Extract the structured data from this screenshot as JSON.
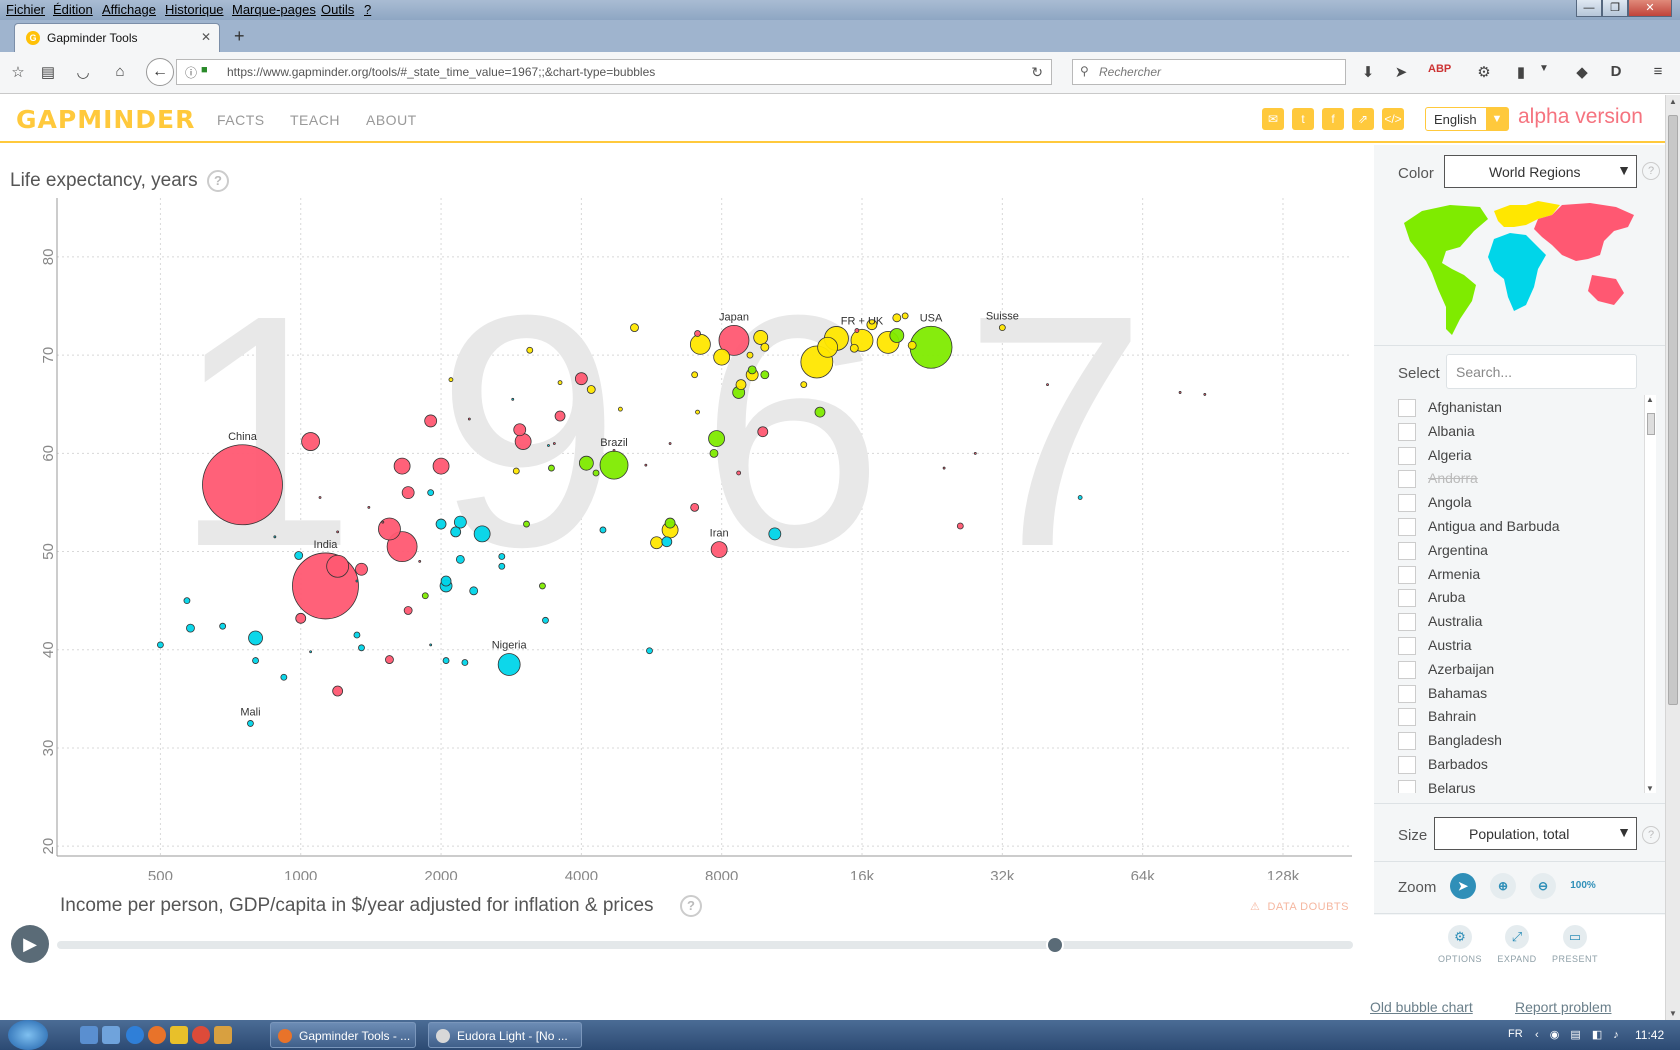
{
  "browser": {
    "menu": [
      "Fichier",
      "Édition",
      "Affichage",
      "Historique",
      "Marque-pages",
      "Outils",
      "?"
    ],
    "tab_title": "Gapminder Tools",
    "url_host": "https://www.gapminder.org",
    "url_path": "/tools/#_state_time_value=1967;;&chart-type=bubbles",
    "search_placeholder": "Rechercher"
  },
  "header": {
    "logo": "GAPMINDER",
    "nav": [
      "FACTS",
      "TEACH",
      "ABOUT"
    ],
    "language": "English",
    "badge": "alpha version",
    "social_icons": [
      "mail-icon",
      "twitter-icon",
      "facebook-icon",
      "share-icon",
      "embed-icon"
    ]
  },
  "chart": {
    "y_title": "Life expectancy, years",
    "x_title": "Income per person, GDP/capita in $/year adjusted for inflation & prices",
    "data_doubts": "DATA DOUBTS",
    "year": "1967"
  },
  "chart_data": {
    "type": "scatter",
    "title": "",
    "xlabel": "Income per person, GDP/capita in $/year adjusted for inflation & prices",
    "ylabel": "Life expectancy, years",
    "x_scale": "log2",
    "xlim": [
      300,
      180000
    ],
    "ylim": [
      19,
      86
    ],
    "x_ticks": [
      500,
      1000,
      2000,
      4000,
      8000,
      16000,
      32000,
      64000,
      128000
    ],
    "x_tick_labels": [
      "500",
      "1000",
      "2000",
      "4000",
      "8000",
      "16k",
      "32k",
      "64k",
      "128k"
    ],
    "y_ticks": [
      20,
      30,
      40,
      50,
      60,
      70,
      80
    ],
    "y_tick_labels": [
      "20",
      "30",
      "40",
      "50",
      "60",
      "70",
      "80"
    ],
    "grid": true,
    "year": "1967",
    "colors": {
      "Asia": "#ff5872",
      "Africa": "#00d5e9",
      "Americas": "#7feb00",
      "Europe": "#ffe700"
    },
    "labeled": [
      {
        "name": "China",
        "x": 750,
        "y": 56.8,
        "size": 40,
        "region": "Asia"
      },
      {
        "name": "India",
        "x": 1130,
        "y": 46.5,
        "size": 33,
        "region": "Asia"
      },
      {
        "name": "Japan",
        "x": 8500,
        "y": 71.5,
        "size": 15,
        "region": "Asia"
      },
      {
        "name": "USA",
        "x": 22500,
        "y": 70.8,
        "size": 21,
        "region": "Americas"
      },
      {
        "name": "Brazil",
        "x": 4700,
        "y": 58.8,
        "size": 14,
        "region": "Americas"
      },
      {
        "name": "FR + UK",
        "x": 16000,
        "y": 71.5,
        "size": 11,
        "region": "Europe"
      },
      {
        "name": "Suisse",
        "x": 32000,
        "y": 72.8,
        "size": 3,
        "region": "Europe"
      },
      {
        "name": "Iran",
        "x": 7900,
        "y": 50.2,
        "size": 8,
        "region": "Asia"
      },
      {
        "name": "Nigeria",
        "x": 2800,
        "y": 38.5,
        "size": 11,
        "region": "Africa"
      },
      {
        "name": "Mali",
        "x": 780,
        "y": 32.5,
        "size": 3,
        "region": "Africa"
      }
    ],
    "points": [
      [
        1050,
        61.2,
        9,
        "Asia"
      ],
      [
        1650,
        58.7,
        8,
        "Asia"
      ],
      [
        2000,
        58.7,
        8,
        "Asia"
      ],
      [
        1900,
        63.3,
        6,
        "Asia"
      ],
      [
        2950,
        62.4,
        6,
        "Asia"
      ],
      [
        3000,
        61.2,
        8,
        "Asia"
      ],
      [
        3600,
        63.8,
        5,
        "Asia"
      ],
      [
        4000,
        67.6,
        6,
        "Asia"
      ],
      [
        1700,
        56.0,
        6,
        "Asia"
      ],
      [
        1550,
        52.3,
        11,
        "Asia"
      ],
      [
        1650,
        50.5,
        15,
        "Asia"
      ],
      [
        1200,
        48.5,
        11,
        "Asia"
      ],
      [
        1350,
        48.2,
        6,
        "Asia"
      ],
      [
        1000,
        43.2,
        5,
        "Asia"
      ],
      [
        1200,
        35.8,
        5,
        "Asia"
      ],
      [
        1550,
        39.0,
        4,
        "Asia"
      ],
      [
        1700,
        44.0,
        4,
        "Asia"
      ],
      [
        7000,
        54.5,
        4,
        "Asia"
      ],
      [
        9800,
        62.2,
        5,
        "Asia"
      ],
      [
        26000,
        52.6,
        3,
        "Asia"
      ],
      [
        8700,
        58.0,
        2,
        "Asia"
      ],
      [
        7100,
        72.2,
        3,
        "Asia"
      ],
      [
        15600,
        72.5,
        2,
        "Asia"
      ],
      [
        500,
        40.5,
        3,
        "Africa"
      ],
      [
        570,
        45.0,
        3,
        "Africa"
      ],
      [
        580,
        42.2,
        4,
        "Africa"
      ],
      [
        680,
        42.4,
        3,
        "Africa"
      ],
      [
        800,
        41.2,
        7,
        "Africa"
      ],
      [
        800,
        38.9,
        3,
        "Africa"
      ],
      [
        920,
        37.2,
        3,
        "Africa"
      ],
      [
        990,
        49.6,
        4,
        "Africa"
      ],
      [
        2000,
        52.8,
        5,
        "Africa"
      ],
      [
        2200,
        53.0,
        6,
        "Africa"
      ],
      [
        2150,
        52.0,
        5,
        "Africa"
      ],
      [
        2450,
        51.8,
        8,
        "Africa"
      ],
      [
        2200,
        49.2,
        4,
        "Africa"
      ],
      [
        2050,
        46.5,
        6,
        "Africa"
      ],
      [
        2050,
        47.0,
        5,
        "Africa"
      ],
      [
        2350,
        46.0,
        4,
        "Africa"
      ],
      [
        2700,
        49.5,
        3,
        "Africa"
      ],
      [
        2700,
        48.5,
        3,
        "Africa"
      ],
      [
        2050,
        38.9,
        3,
        "Africa"
      ],
      [
        2250,
        38.7,
        3,
        "Africa"
      ],
      [
        3350,
        43.0,
        3,
        "Africa"
      ],
      [
        4450,
        52.2,
        3,
        "Africa"
      ],
      [
        5600,
        39.9,
        3,
        "Africa"
      ],
      [
        6100,
        51.0,
        5,
        "Africa"
      ],
      [
        10400,
        51.8,
        6,
        "Africa"
      ],
      [
        47000,
        55.5,
        2,
        "Africa"
      ],
      [
        1900,
        56.0,
        3,
        "Africa"
      ],
      [
        1350,
        40.2,
        3,
        "Africa"
      ],
      [
        1320,
        41.5,
        3,
        "Africa"
      ],
      [
        3300,
        46.5,
        3,
        "Americas"
      ],
      [
        3450,
        58.5,
        3,
        "Americas"
      ],
      [
        4100,
        59.0,
        7,
        "Americas"
      ],
      [
        4300,
        58.0,
        3,
        "Americas"
      ],
      [
        6200,
        52.9,
        5,
        "Americas"
      ],
      [
        7800,
        61.5,
        8,
        "Americas"
      ],
      [
        7700,
        60.0,
        4,
        "Americas"
      ],
      [
        8700,
        66.2,
        6,
        "Americas"
      ],
      [
        9300,
        68.5,
        4,
        "Americas"
      ],
      [
        9900,
        68.0,
        4,
        "Americas"
      ],
      [
        13000,
        64.2,
        5,
        "Americas"
      ],
      [
        19000,
        72.0,
        7,
        "Americas"
      ],
      [
        3050,
        52.8,
        3,
        "Americas"
      ],
      [
        1850,
        45.5,
        3,
        "Americas"
      ],
      [
        5200,
        72.8,
        4,
        "Europe"
      ],
      [
        5800,
        50.9,
        6,
        "Europe"
      ],
      [
        6200,
        52.2,
        8,
        "Europe"
      ],
      [
        4200,
        66.5,
        4,
        "Europe"
      ],
      [
        7000,
        68.0,
        3,
        "Europe"
      ],
      [
        7200,
        71.1,
        10,
        "Europe"
      ],
      [
        8000,
        69.8,
        8,
        "Europe"
      ],
      [
        8800,
        67.0,
        5,
        "Europe"
      ],
      [
        9300,
        68.0,
        6,
        "Europe"
      ],
      [
        9200,
        70.0,
        3,
        "Europe"
      ],
      [
        9700,
        71.8,
        7,
        "Europe"
      ],
      [
        9900,
        70.8,
        4,
        "Europe"
      ],
      [
        12000,
        67.0,
        3,
        "Europe"
      ],
      [
        12800,
        69.3,
        16,
        "Europe"
      ],
      [
        13500,
        70.8,
        10,
        "Europe"
      ],
      [
        14100,
        71.7,
        12,
        "Europe"
      ],
      [
        15400,
        70.7,
        4,
        "Europe"
      ],
      [
        16800,
        73.1,
        5,
        "Europe"
      ],
      [
        18200,
        71.3,
        11,
        "Europe"
      ],
      [
        19000,
        73.8,
        4,
        "Europe"
      ],
      [
        19800,
        74.0,
        3,
        "Europe"
      ],
      [
        20500,
        71.0,
        4,
        "Europe"
      ],
      [
        3100,
        70.5,
        3,
        "Europe"
      ],
      [
        2100,
        67.5,
        2,
        "Europe"
      ],
      [
        3600,
        67.2,
        2,
        "Europe"
      ],
      [
        4850,
        64.5,
        2,
        "Europe"
      ],
      [
        7100,
        64.2,
        2,
        "Europe"
      ],
      [
        2900,
        58.2,
        3,
        "Europe"
      ],
      [
        1100,
        55.5,
        1,
        "Asia"
      ],
      [
        1200,
        52.0,
        1,
        "Asia"
      ],
      [
        1400,
        54.5,
        1,
        "Asia"
      ],
      [
        1500,
        53.0,
        1,
        "Asia"
      ],
      [
        1800,
        49.0,
        1,
        "Asia"
      ],
      [
        2300,
        63.5,
        1,
        "Asia"
      ],
      [
        3500,
        61.0,
        1,
        "Asia"
      ],
      [
        4700,
        60.3,
        1,
        "Asia"
      ],
      [
        5500,
        58.8,
        1,
        "Asia"
      ],
      [
        6200,
        61.0,
        1,
        "Asia"
      ],
      [
        24000,
        58.5,
        1,
        "Asia"
      ],
      [
        28000,
        60.0,
        1,
        "Asia"
      ],
      [
        40000,
        67.0,
        1,
        "Asia"
      ],
      [
        77000,
        66.2,
        1,
        "Asia"
      ],
      [
        87000,
        66.0,
        1,
        "Asia"
      ],
      [
        1050,
        39.8,
        1,
        "Africa"
      ],
      [
        1900,
        40.5,
        1,
        "Africa"
      ],
      [
        880,
        51.5,
        1,
        "Africa"
      ],
      [
        3400,
        60.8,
        1,
        "Africa"
      ],
      [
        2850,
        65.5,
        1,
        "Africa"
      ],
      [
        1320,
        47.0,
        1,
        "Africa"
      ]
    ]
  },
  "timeslider": {
    "play_label": "play",
    "position": 0.77
  },
  "panel": {
    "color_label": "Color",
    "color_value": "World Regions",
    "select_label": "Select",
    "search_placeholder": "Search...",
    "countries": [
      "Afghanistan",
      "Albania",
      "Algeria",
      "Andorra",
      "Angola",
      "Antigua and Barbuda",
      "Argentina",
      "Armenia",
      "Aruba",
      "Australia",
      "Austria",
      "Azerbaijan",
      "Bahamas",
      "Bahrain",
      "Bangladesh",
      "Barbados",
      "Belarus"
    ],
    "disabled_countries": [
      "Andorra"
    ],
    "size_label": "Size",
    "size_value": "Population, total",
    "zoom_label": "Zoom",
    "zoom_reset": "100%"
  },
  "tools": [
    {
      "label": "OPTIONS",
      "icon": "gear-icon"
    },
    {
      "label": "EXPAND",
      "icon": "expand-icon"
    },
    {
      "label": "PRESENT",
      "icon": "present-icon"
    }
  ],
  "footer": {
    "old_chart": "Old bubble chart",
    "report": "Report problem"
  },
  "taskbar": {
    "tasks": [
      "Gapminder Tools - ...",
      "Eudora Light - [No ..."
    ],
    "lang": "FR",
    "clock": "11:42"
  }
}
